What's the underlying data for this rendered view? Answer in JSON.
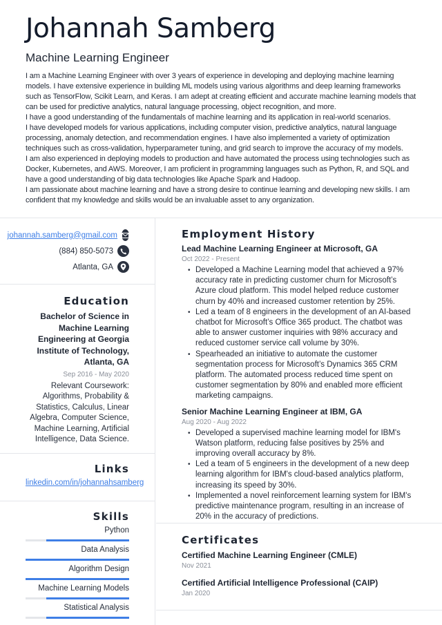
{
  "header": {
    "name": "Johannah Samberg",
    "title": "Machine Learning Engineer",
    "summary": [
      "I am a Machine Learning Engineer with over 3 years of experience in developing and deploying machine learning models. I have extensive experience in building ML models using various algorithms and deep learning frameworks such as TensorFlow, Scikit Learn, and Keras. I am adept at creating efficient and accurate machine learning models that can be used for predictive analytics, natural language processing, object recognition, and more.",
      "I have a good understanding of the fundamentals of machine learning and its application in real-world scenarios.",
      "I have developed models for various applications, including computer vision, predictive analytics, natural language processing, anomaly detection, and recommendation engines. I have also implemented a variety of optimization techniques such as cross-validation, hyperparameter tuning, and grid search to improve the accuracy of my models.",
      "I am also experienced in deploying models to production and have automated the process using technologies such as Docker, Kubernetes, and AWS. Moreover, I am proficient in programming languages such as Python, R, and SQL and have a good understanding of big data technologies like Apache Spark and Hadoop.",
      "I am passionate about machine learning and have a strong desire to continue learning and developing new skills. I am confident that my knowledge and skills would be an invaluable asset to any organization."
    ]
  },
  "contact": {
    "email": "johannah.samberg@gmail.com",
    "phone": "(884) 850-5073",
    "location": "Atlanta, GA",
    "icons": [
      "envelope-icon",
      "phone-icon",
      "map-pin-icon"
    ]
  },
  "education": {
    "heading": "Education",
    "degree": "Bachelor of Science in Machine Learning Engineering at Georgia Institute of Technology, Atlanta, GA",
    "dates": "Sep 2016 - May 2020",
    "description": "Relevant Coursework: Algorithms, Probability & Statistics, Calculus, Linear Algebra, Computer Science, Machine Learning, Artificial Intelligence, Data Science."
  },
  "links": {
    "heading": "Links",
    "items": [
      "linkedin.com/in/johannahsamberg"
    ]
  },
  "skills": {
    "heading": "Skills",
    "items": [
      {
        "name": "Python",
        "level": 0.8
      },
      {
        "name": "Data Analysis",
        "level": 1.0
      },
      {
        "name": "Algorithm Design",
        "level": 1.0
      },
      {
        "name": "Machine Learning Models",
        "level": 0.8
      },
      {
        "name": "Statistical Analysis",
        "level": 0.8
      }
    ]
  },
  "employment": {
    "heading": "Employment History",
    "jobs": [
      {
        "title": "Lead Machine Learning Engineer at Microsoft, GA",
        "dates": "Oct 2022 - Present",
        "bullets": [
          "Developed a Machine Learning model that achieved a 97% accuracy rate in predicting customer churn for Microsoft’s Azure cloud platform. This model helped reduce customer churn by 40% and increased customer retention by 25%.",
          "Led a team of 8 engineers in the development of an AI-based chatbot for Microsoft’s Office 365 product. The chatbot was able to answer customer inquiries with 98% accuracy and reduced customer service call volume by 30%.",
          "Spearheaded an initiative to automate the customer segmentation process for Microsoft’s Dynamics 365 CRM platform. The automated process reduced time spent on customer segmentation by 80% and enabled more efficient marketing campaigns."
        ]
      },
      {
        "title": "Senior Machine Learning Engineer at IBM, GA",
        "dates": "Aug 2020 - Aug 2022",
        "bullets": [
          "Developed a supervised machine learning model for IBM's Watson platform, reducing false positives by 25% and improving overall accuracy by 8%.",
          "Led a team of 5 engineers in the development of a new deep learning algorithm for IBM's cloud-based analytics platform, increasing its speed by 30%.",
          "Implemented a novel reinforcement learning system for IBM's predictive maintenance program, resulting in an increase of 20% in the accuracy of predictions."
        ]
      }
    ]
  },
  "certificates": {
    "heading": "Certificates",
    "items": [
      {
        "name": "Certified Machine Learning Engineer (CMLE)",
        "date": "Nov 2021"
      },
      {
        "name": "Certified Artificial Intelligence Professional (CAIP)",
        "date": "Jan 2020"
      }
    ]
  },
  "colors": {
    "accent": "#3e7ee6",
    "text": "#1e2532",
    "muted": "#8a8f99",
    "divider": "#e4e6ea",
    "icon_bg": "#2b3240"
  }
}
